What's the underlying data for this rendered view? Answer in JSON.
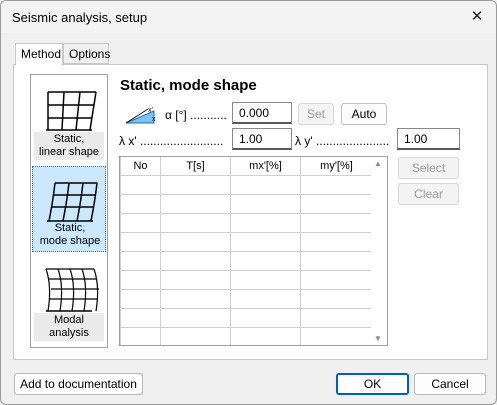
{
  "window": {
    "title": "Seismic analysis, setup",
    "close": "✕"
  },
  "tabs": [
    {
      "label": "Method",
      "active": true
    },
    {
      "label": "Options",
      "active": false
    }
  ],
  "methods": [
    {
      "label_line1": "Static,",
      "label_line2": "linear shape",
      "selected": false
    },
    {
      "label_line1": "Static,",
      "label_line2": "mode shape",
      "selected": true
    },
    {
      "label_line1": "Modal",
      "label_line2": "analysis",
      "selected": false
    }
  ],
  "section": {
    "heading": "Static, mode shape"
  },
  "alpha": {
    "label": "α [°] ...........",
    "value": "0.000",
    "set_label": "Set",
    "auto_label": "Auto"
  },
  "lambda_x": {
    "label": "λ x' .........................",
    "value": "1.00"
  },
  "lambda_y": {
    "label": "λ y' ......................",
    "value": "1.00"
  },
  "table": {
    "columns": [
      "No",
      "T[s]",
      "mx'[%]",
      "my'[%]"
    ],
    "empty_rows": 9
  },
  "side_buttons": {
    "select": "Select",
    "clear": "Clear"
  },
  "footer": {
    "add_doc": "Add to documentation",
    "ok": "OK",
    "cancel": "Cancel"
  },
  "colors": {
    "selection": "#cce8ff",
    "accent": "#005fb8"
  }
}
